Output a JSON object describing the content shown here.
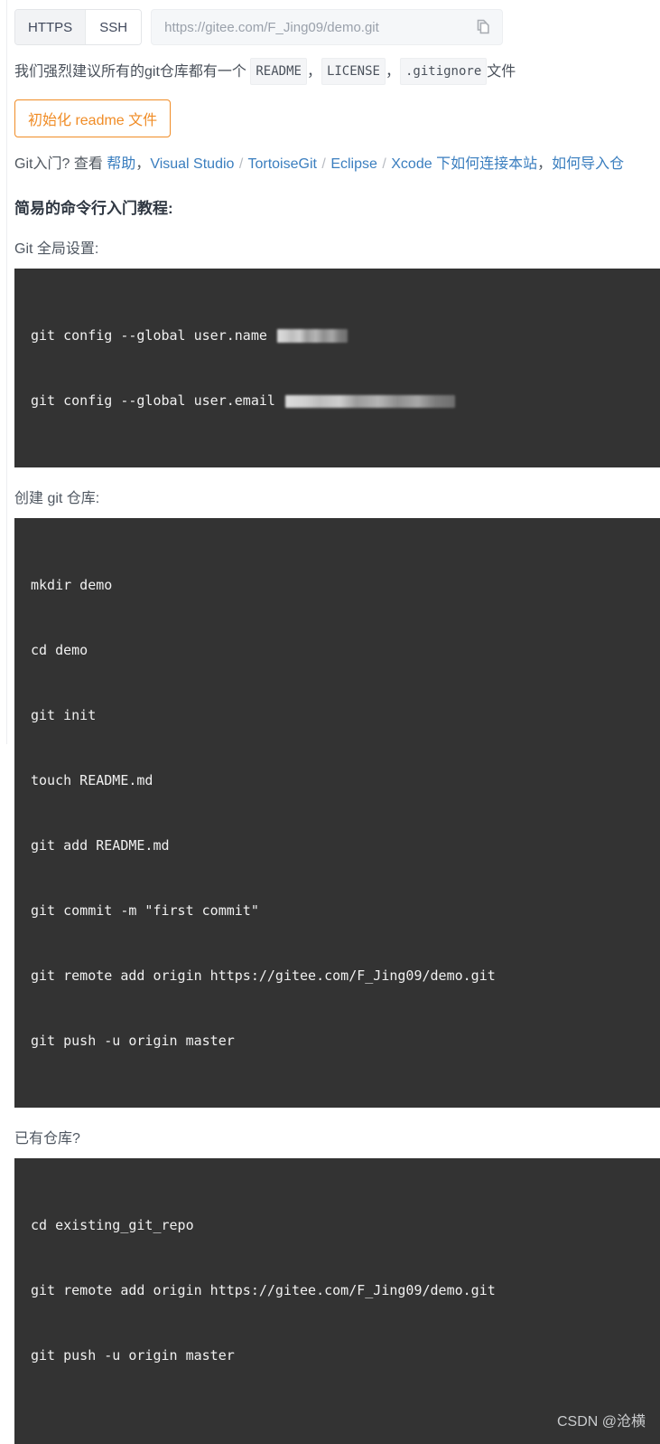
{
  "clone_bar": {
    "protocols": [
      {
        "label": "HTTPS",
        "active": true
      },
      {
        "label": "SSH",
        "active": false
      }
    ],
    "url_value": "https://gitee.com/F_Jing09/demo.git",
    "copy_icon": "copy-icon"
  },
  "advisory": {
    "prefix": "我们强烈建议所有的git仓库都有一个",
    "chips": [
      "README",
      "LICENSE",
      ".gitignore"
    ],
    "comma": "，",
    "suffix": "文件"
  },
  "readme_button": {
    "label": "初始化 readme 文件",
    "accent": "#f08c26"
  },
  "intro": {
    "lead": "Git入门?",
    "view": "查看",
    "help_link": "帮助",
    "comma": "，",
    "ide_links": [
      "Visual Studio",
      "TortoiseGit",
      "Eclipse",
      "Xcode"
    ],
    "separator": "/",
    "tail": "下如何连接本站",
    "tail_comma": "，",
    "import_link": "如何导入仓"
  },
  "tutorial": {
    "title": "简易的命令行入门教程:",
    "sections": [
      {
        "label": "Git 全局设置:",
        "lines": [
          {
            "text": "git config --global user.name ",
            "redacted": "name"
          },
          {
            "text": "git config --global user.email ",
            "redacted": "email"
          }
        ]
      },
      {
        "label": "创建 git 仓库:",
        "lines": [
          {
            "text": "mkdir demo"
          },
          {
            "text": "cd demo"
          },
          {
            "text": "git init"
          },
          {
            "text": "touch README.md"
          },
          {
            "text": "git add README.md"
          },
          {
            "text": "git commit -m \"first commit\""
          },
          {
            "text": "git remote add origin https://gitee.com/F_Jing09/demo.git"
          },
          {
            "text": "git push -u origin master"
          }
        ]
      },
      {
        "label": "已有仓库?",
        "lines": [
          {
            "text": "cd existing_git_repo"
          },
          {
            "text": "git remote add origin https://gitee.com/F_Jing09/demo.git"
          },
          {
            "text": "git push -u origin master"
          }
        ]
      }
    ]
  },
  "watermark": "CSDN @沧横"
}
